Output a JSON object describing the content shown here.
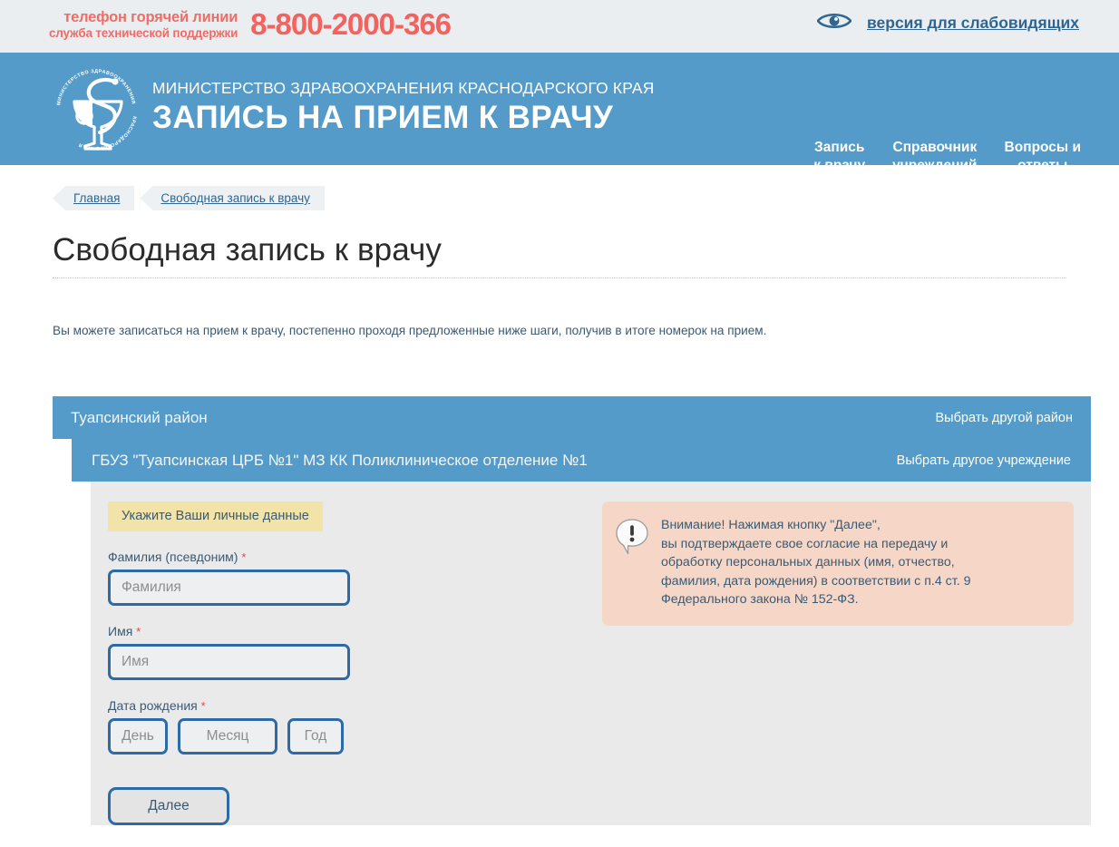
{
  "topbar": {
    "hotline_line1": "телефон горячей линии",
    "hotline_line2": "служба технической поддержки",
    "hotline_number": "8-800-2000-366",
    "accessibility_label": "версия для слабовидящих",
    "accessibility_icon": "eye-icon",
    "bg_color": "#eaeef1",
    "hotline_color": "#f4625d",
    "link_color": "#2f6590"
  },
  "header": {
    "ministry": "МИНИСТЕРСТВО ЗДРАВООХРАНЕНИЯ КРАСНОДАРСКОГО КРАЯ",
    "title": "ЗАПИСЬ НА ПРИЕМ К ВРАЧУ",
    "logo_icon": "bowl-of-hygieia-logo",
    "logo_ring_text": "МИНИСТЕРСТВО ЗДРАВООХРАНЕНИЯ КРАСНОДАРСКОГО КРАЯ",
    "bg_color": "#549bc9",
    "nav": [
      {
        "label": "Запись\nк врачу"
      },
      {
        "label": "Справочник\nучреждений"
      },
      {
        "label": "Вопросы и\nответы"
      }
    ]
  },
  "breadcrumbs": [
    {
      "label": "Главная"
    },
    {
      "label": "Свободная запись к врачу"
    }
  ],
  "page": {
    "title": "Свободная запись к врачу",
    "intro": "Вы можете записаться на прием к врачу, постепенно проходя предложенные ниже шаги, получив в итоге номерок на прием."
  },
  "wizard": {
    "region": {
      "name": "Туапсинский район",
      "change_label": "Выбрать другой район"
    },
    "institution": {
      "name": "ГБУЗ \"Туапсинская ЦРБ №1\" МЗ КК Поликлиническое отделение №1",
      "change_label": "Выбрать другое учреждение"
    },
    "form": {
      "step_badge": "Укажите Ваши личные данные",
      "surname": {
        "label": "Фамилия (псевдоним)",
        "required_mark": "*",
        "placeholder": "Фамилия",
        "value": ""
      },
      "firstname": {
        "label": "Имя",
        "required_mark": "*",
        "placeholder": "Имя",
        "value": ""
      },
      "birthdate": {
        "label": "Дата рождения",
        "required_mark": "*",
        "day_placeholder": "День",
        "month_placeholder": "Месяц",
        "year_placeholder": "Год",
        "day_value": "",
        "month_value": "",
        "year_value": ""
      },
      "next_button": "Далее",
      "panel_bg": "#eaeaea",
      "badge_bg": "#f2e3a8",
      "input_border": "#2c6ba5"
    },
    "notice": {
      "icon": "exclamation-bubble-icon",
      "text": "Внимание! Нажимая кнопку \"Далее\",\nвы подтверждаете свое согласие на передачу и\nобработку персональных данных (имя, отчество,\nфамилия, дата рождения) в соответствии с п.4 ст. 9\nФедерального закона № 152-ФЗ.",
      "bg_color": "#f6d7c7"
    }
  }
}
